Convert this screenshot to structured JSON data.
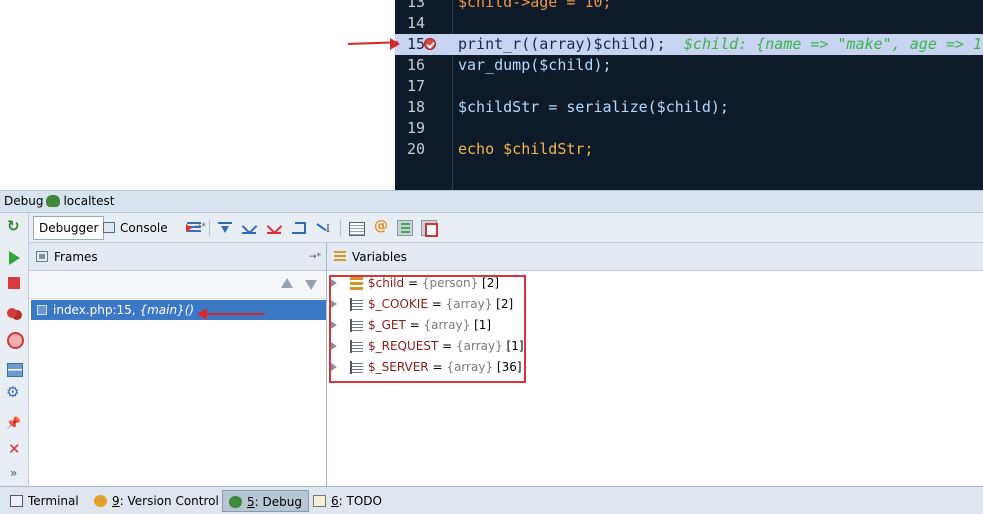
{
  "editor": {
    "lines": [
      {
        "num": "13",
        "code": "$child->age = 10;"
      },
      {
        "num": "14",
        "code": ""
      },
      {
        "num": "15",
        "code": "print_r((array)$child);",
        "inline": "$child: {name => \"make\", age => 1"
      },
      {
        "num": "16",
        "code": "var_dump($child);"
      },
      {
        "num": "17",
        "code": ""
      },
      {
        "num": "18",
        "code": "$childStr = serialize($child);"
      },
      {
        "num": "19",
        "code": ""
      },
      {
        "num": "20",
        "code": "echo $childStr;"
      }
    ]
  },
  "debug": {
    "title": "Debug",
    "config_name": "localtest"
  },
  "toolbar": {
    "debugger_tab": "Debugger",
    "console_tab": "Console",
    "pin_symbol": "→*"
  },
  "frames": {
    "title": "Frames",
    "pin_symbol": "→*",
    "selected": {
      "location": "index.php:15,",
      "function": "{main}()"
    }
  },
  "variables": {
    "title": "Variables",
    "items": [
      {
        "name": "$child",
        "eq": " = ",
        "type": "{person}",
        "count": " [2]",
        "icon": "object-icon"
      },
      {
        "name": "$_COOKIE",
        "eq": " = ",
        "type": "{array}",
        "count": " [2]",
        "icon": "array-icon"
      },
      {
        "name": "$_GET",
        "eq": " = ",
        "type": "{array}",
        "count": " [1]",
        "icon": "array-icon"
      },
      {
        "name": "$_REQUEST",
        "eq": " = ",
        "type": "{array}",
        "count": " [1]",
        "icon": "array-icon"
      },
      {
        "name": "$_SERVER",
        "eq": " = ",
        "type": "{array}",
        "count": " [36]",
        "icon": "array-icon"
      }
    ]
  },
  "bottom_tabs": {
    "terminal": "Terminal",
    "vcs_mnemonic": "9",
    "vcs_rest": ": Version Control",
    "debug_mnemonic": "5",
    "debug_rest": ": Debug",
    "todo_mnemonic": "6",
    "todo_rest": ": TODO"
  },
  "colors": {
    "editor_bg": "#0e1a2a",
    "current_line": "#c9d3f2",
    "selection": "#3b78c6",
    "annotation_red": "#d8343c"
  }
}
